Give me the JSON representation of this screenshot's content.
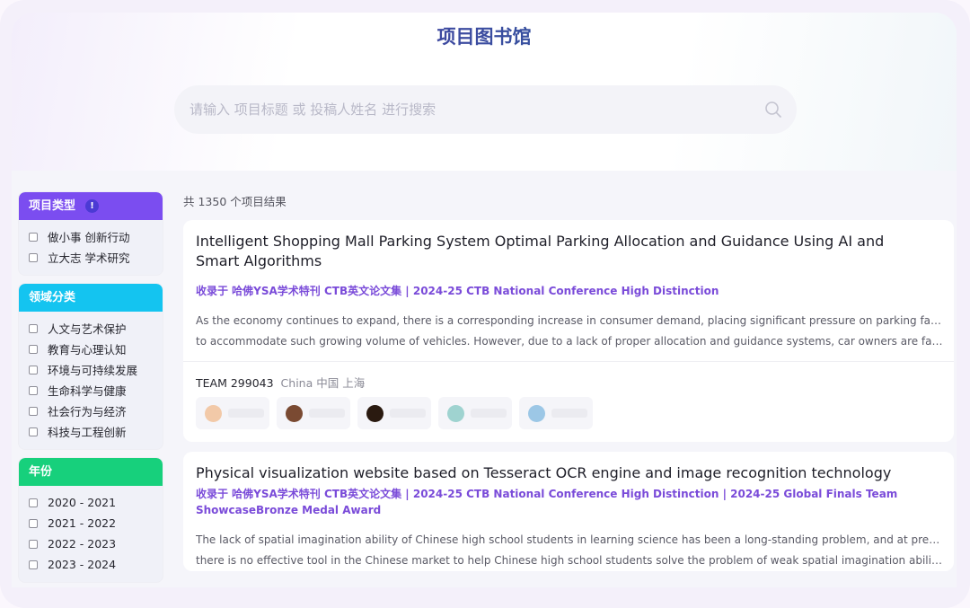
{
  "header": {
    "title": "项目图书馆",
    "search_placeholder": "请输入 项目标题 或 投稿人姓名 进行搜索"
  },
  "filters": [
    {
      "title": "项目类型",
      "info_badge": "!",
      "color": "#7b4df0",
      "options": [
        "做小事 创新行动",
        "立大志 学术研究"
      ]
    },
    {
      "title": "领域分类",
      "color": "#14c4f0",
      "options": [
        "人文与艺术保护",
        "教育与心理认知",
        "环境与可持续发展",
        "生命科学与健康",
        "社会行为与经济",
        "科技与工程创新"
      ]
    },
    {
      "title": "年份",
      "color": "#17d07c",
      "options": [
        "2020 - 2021",
        "2021 - 2022",
        "2022 - 2023",
        "2023 - 2024"
      ]
    }
  ],
  "results": {
    "count_text": "共 1350 个项目结果",
    "items": [
      {
        "title": "Intelligent Shopping Mall Parking System Optimal Parking Allocation and Guidance Using AI and Smart Algorithms",
        "tags": "收录于 哈佛YSA学术特刊 CTB英文论文集 | 2024-25 CTB National Conference High Distinction",
        "abstract_line1": "As the economy continues to expand, there is a corresponding increase in consumer demand, placing significant pressure on parking facilities",
        "abstract_line2": "to accommodate such growing volume of vehicles. However, due to a lack of proper allocation and guidance systems, car owners are faced…",
        "team_id": "TEAM 299043",
        "team_location": "China 中国 上海",
        "member_avatar_colors": [
          "#f2c9a8",
          "#7a4a32",
          "#2a1a10",
          "#9fd3d0",
          "#9cc7e6"
        ]
      },
      {
        "title": "Physical visualization website based on Tesseract OCR engine and image recognition technology",
        "tags": "收录于 哈佛YSA学术特刊 CTB英文论文集 | 2024-25 CTB National Conference High Distinction | 2024-25 Global Finals Team ShowcaseBronze Medal Award",
        "abstract_line1": "The lack of spatial imagination ability of Chinese high school students in learning science has been a long-standing problem, and at present,",
        "abstract_line2": "there is no effective tool in the Chinese market to help Chinese high school students solve the problem of weak spatial imagination ability. For…"
      }
    ]
  }
}
